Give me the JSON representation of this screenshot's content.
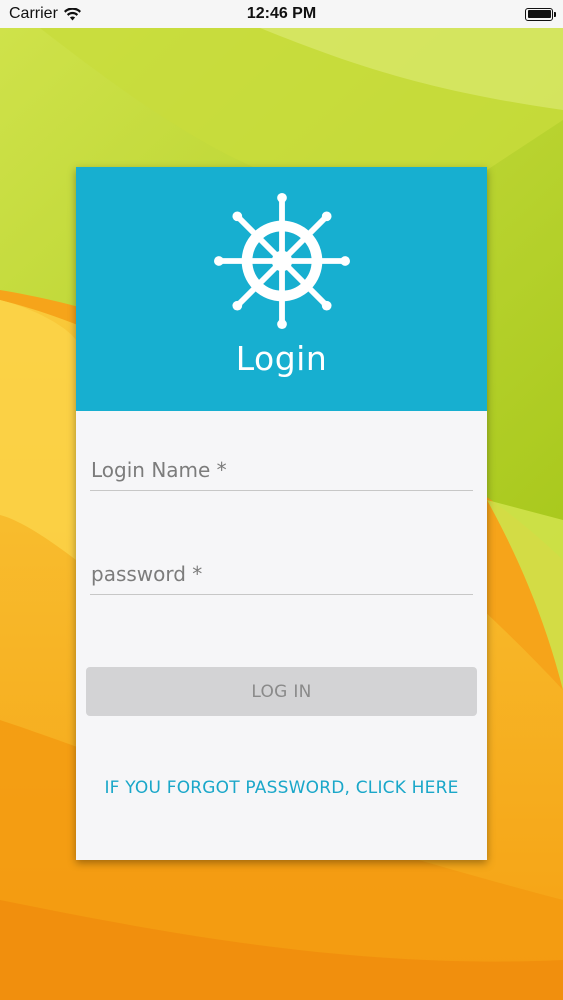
{
  "status_bar": {
    "carrier": "Carrier",
    "time": "12:46 PM"
  },
  "card": {
    "header_icon": "ship-wheel-icon",
    "title": "Login",
    "login_name_placeholder": "Login Name *",
    "password_placeholder": "password *",
    "login_button_label": "LOG IN",
    "forgot_password_link": "IF YOU FORGOT PASSWORD, CLICK HERE"
  },
  "colors": {
    "header_blue": "#17afd0",
    "link_blue": "#1aa7c9",
    "button_gray": "#d3d3d5",
    "card_background": "#f6f6f8"
  }
}
